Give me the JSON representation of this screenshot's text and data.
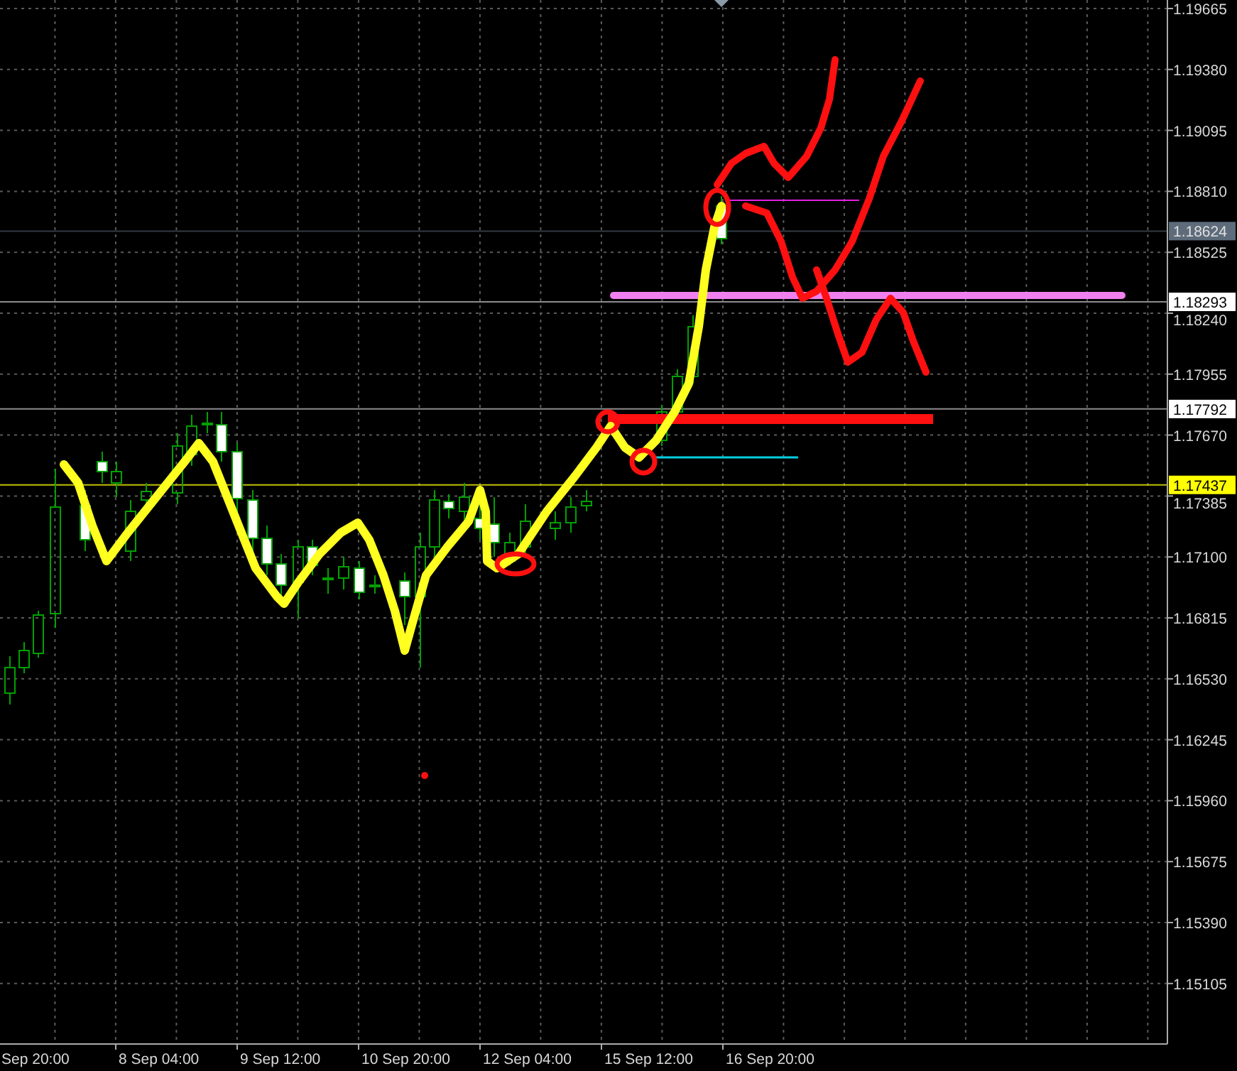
{
  "price_axis": {
    "labels": [
      "1.19665",
      "1.19380",
      "1.19095",
      "1.18810",
      "1.18525",
      "1.18240",
      "1.17955",
      "1.17670",
      "1.17385",
      "1.17100",
      "1.16815",
      "1.16530",
      "1.16245",
      "1.15960",
      "1.15675",
      "1.15390",
      "1.15105"
    ]
  },
  "price_tags": [
    {
      "value": "1.18624",
      "color": "#5d6b7a"
    },
    {
      "value": "1.18293",
      "color": "#ffffff"
    },
    {
      "value": "1.17792",
      "color": "#ffffff"
    },
    {
      "value": "1.17437",
      "color": "#ffff00"
    }
  ],
  "time_axis": {
    "labels": [
      "Sep 20:00",
      "8 Sep 04:00",
      "9 Sep 12:00",
      "10 Sep 20:00",
      "12 Sep 04:00",
      "15 Sep 12:00",
      "16 Sep 20:00"
    ]
  }
}
